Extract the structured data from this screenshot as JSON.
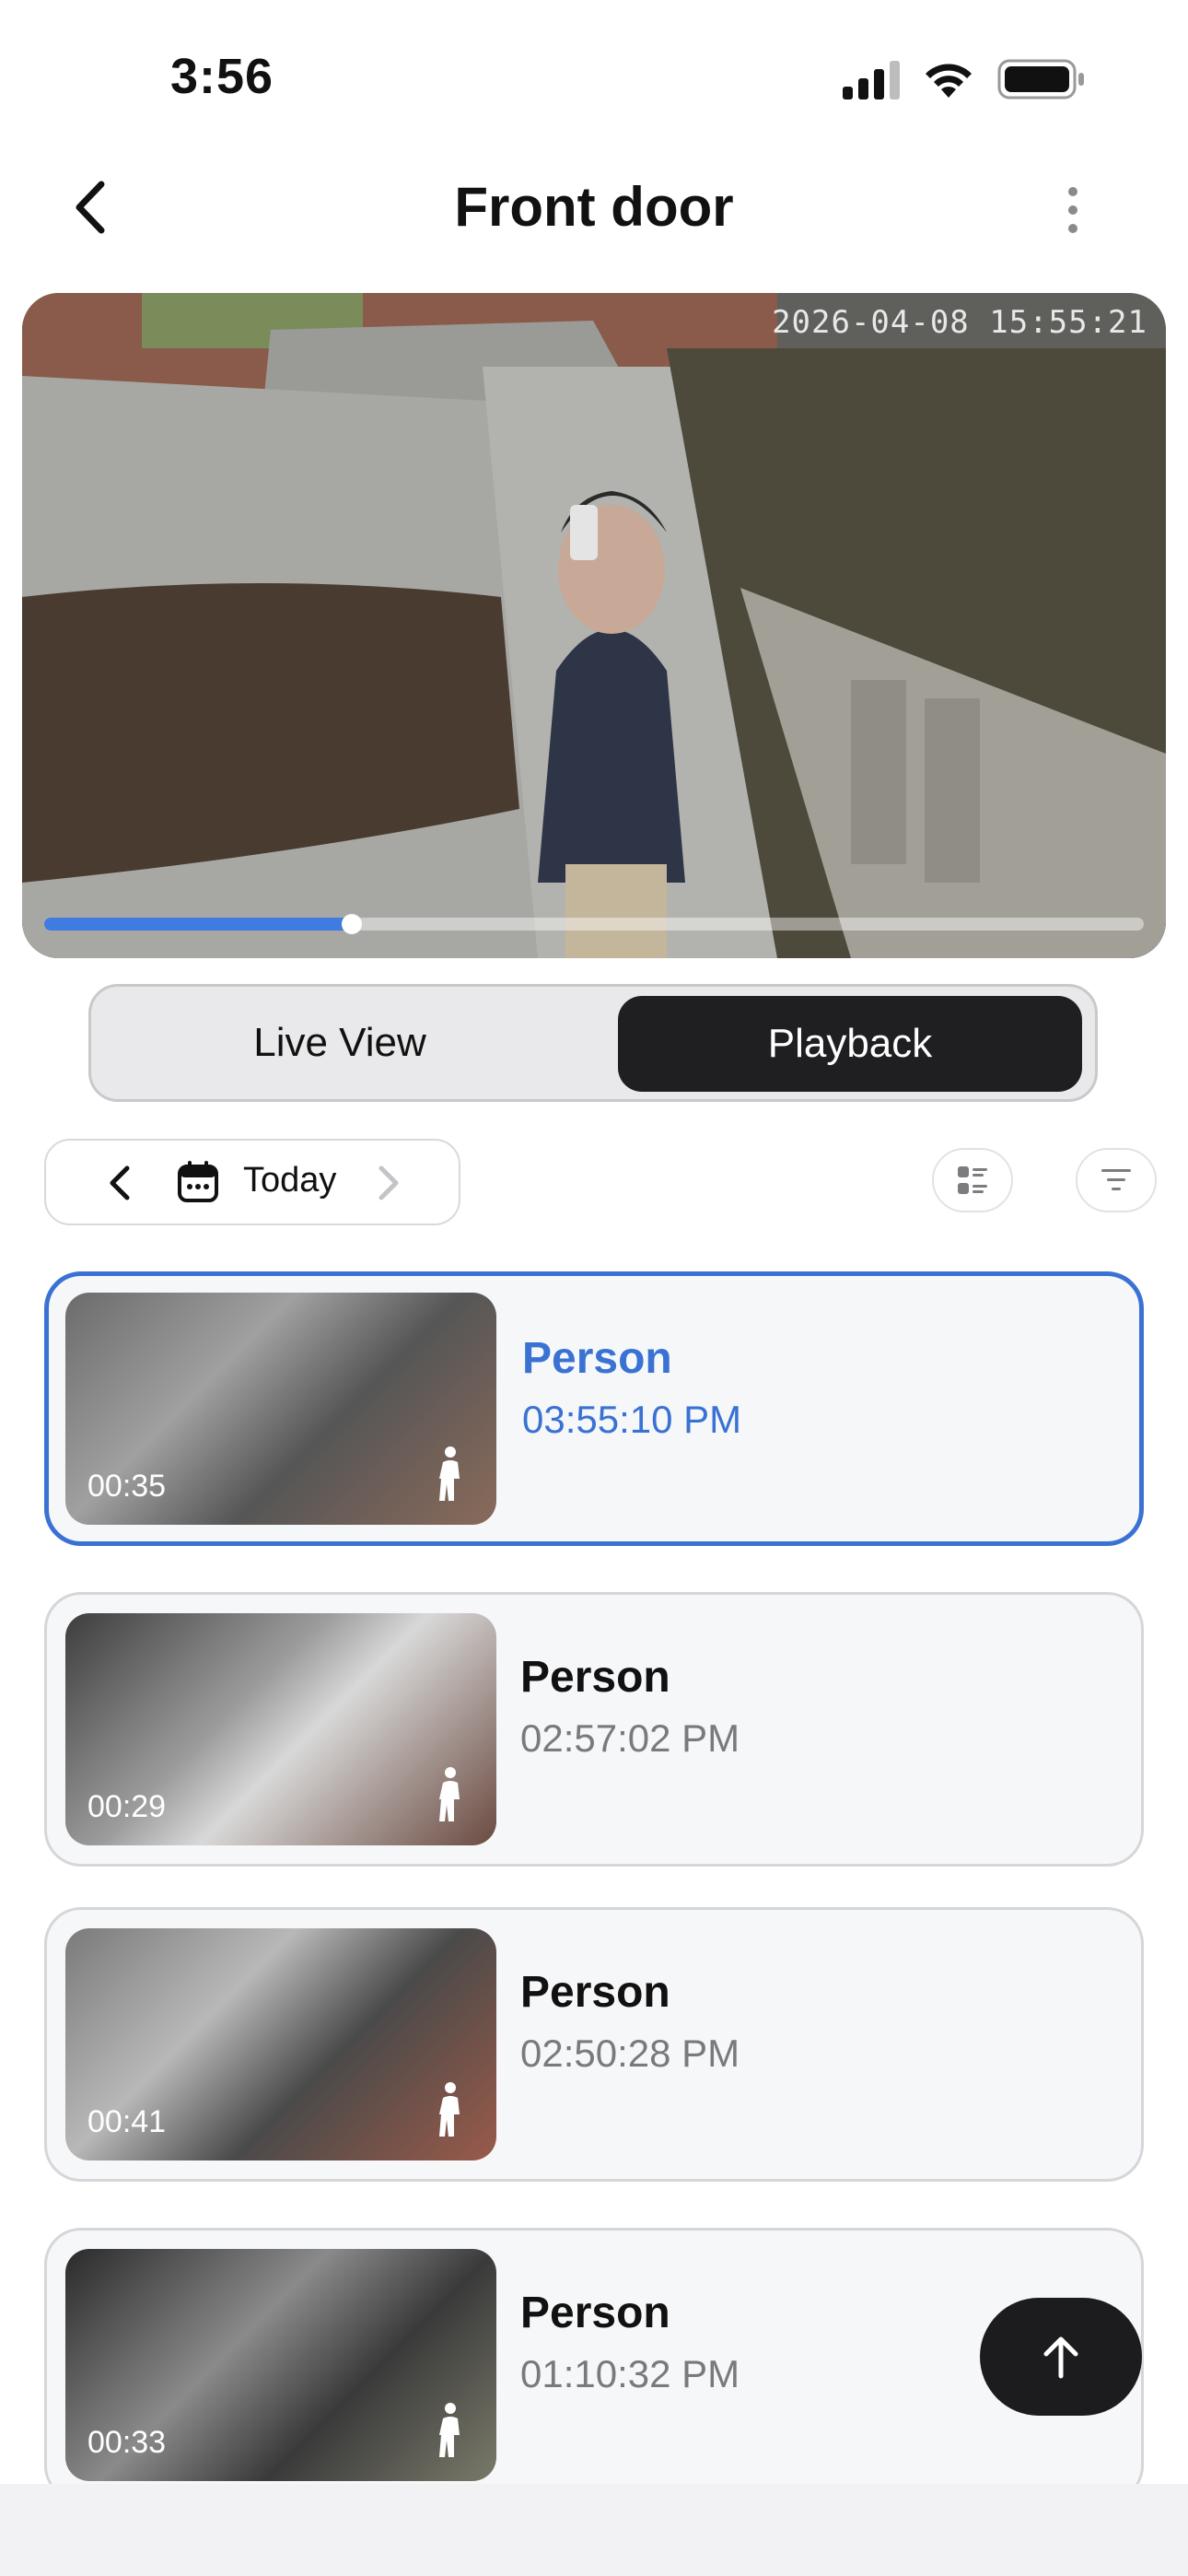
{
  "status_bar": {
    "time": "3:56"
  },
  "header": {
    "title": "Front door"
  },
  "video": {
    "timestamp": "2026-04-08 15:55:21",
    "progress": 0.28
  },
  "segment": {
    "live_label": "Live View",
    "playback_label": "Playback",
    "selected": "Playback"
  },
  "date_selector": {
    "label": "Today"
  },
  "events": [
    {
      "type": "Person",
      "time": "03:55:10 PM",
      "duration": "00:35",
      "selected": true
    },
    {
      "type": "Person",
      "time": "02:57:02 PM",
      "duration": "00:29",
      "selected": false
    },
    {
      "type": "Person",
      "time": "02:50:28 PM",
      "duration": "00:41",
      "selected": false
    },
    {
      "type": "Person",
      "time": "01:10:32 PM",
      "duration": "00:33",
      "selected": false
    }
  ],
  "colors": {
    "accent": "#3a72d4",
    "progress": "#3f7be0",
    "dark": "#1f1f22"
  },
  "icons": [
    "signal-icon",
    "wifi-icon",
    "battery-icon",
    "back-chevron-icon",
    "more-icon",
    "calendar-icon",
    "list-view-icon",
    "filter-icon",
    "person-walking-icon",
    "arrow-up-icon"
  ]
}
